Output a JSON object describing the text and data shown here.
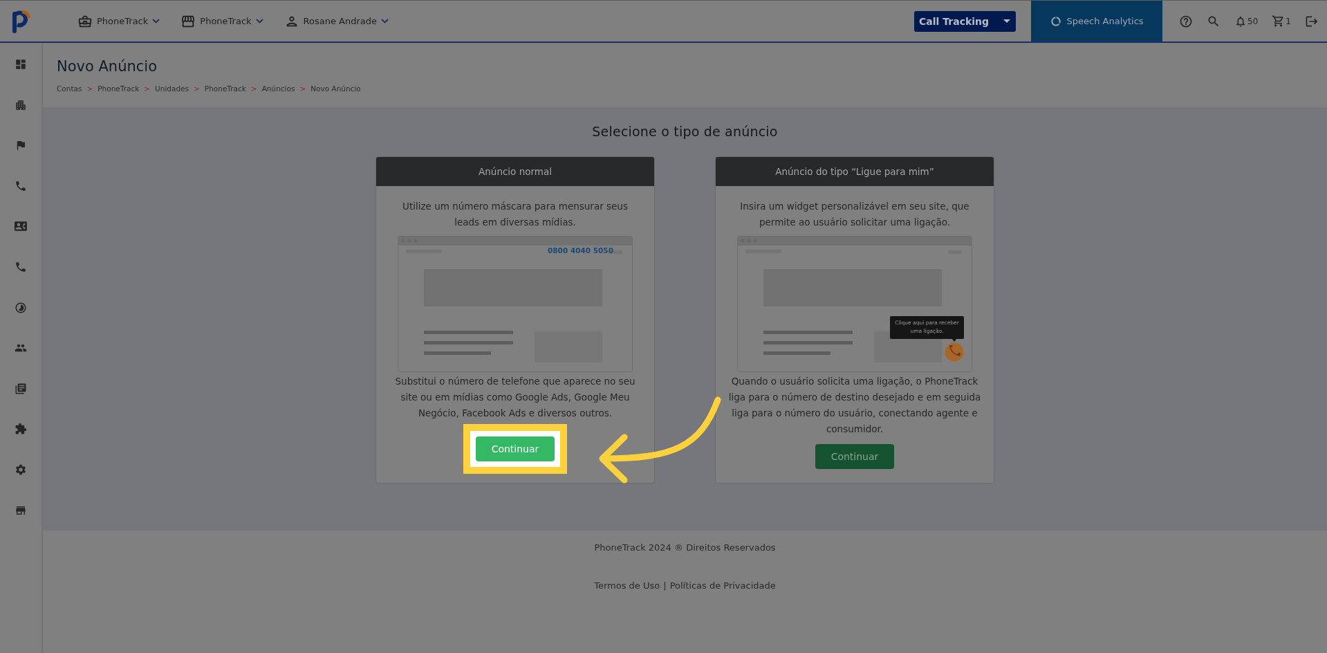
{
  "top_bar": {
    "menus": [
      {
        "label": "PhoneTrack"
      },
      {
        "label": "PhoneTrack"
      },
      {
        "label": "Rosane Andrade"
      }
    ],
    "product_select": "Call Tracking",
    "speech_analytics": "Speech Analytics",
    "notifications": "50",
    "cart": "1"
  },
  "page": {
    "title": "Novo Anúncio",
    "breadcrumb_separator": ">",
    "breadcrumb": [
      "Contas",
      "PhoneTrack",
      "Unidades",
      "PhoneTrack",
      "Anúncios",
      "Novo Anúncio"
    ]
  },
  "selection": {
    "title": "Selecione o tipo de anúncio",
    "cards": [
      {
        "kind": "number",
        "header": "Anúncio normal",
        "intro": "Utilize um número máscara para mensurar seus leads em diversas mídias.",
        "phone_number": "0800 4040 5050",
        "description": "Substitui o número de telefone que aparece no seu site ou em mídias como Google Ads, Google Meu Negócio, Facebook Ads e diversos outros.",
        "button": "Continuar",
        "highlighted": true
      },
      {
        "kind": "callback",
        "header": "Anúncio do tipo “Ligue para mim”",
        "intro": "Insira um widget personalizável em seu site, que permite ao usuário solicitar uma ligação.",
        "tooltip": "Clique aqui para receber uma ligação.",
        "description": "Quando o usuário solicita uma ligação, o PhoneTrack liga para o número de destino desejado e em seguida liga para o número do usuário, conectando agente e consumidor.",
        "button": "Continuar",
        "highlighted": false
      }
    ]
  },
  "footer": {
    "copyright": "PhoneTrack 2024 ® Direitos Reservados",
    "links": [
      "Termos de Uso",
      "Políticas de Privacidade"
    ],
    "separator": "|"
  }
}
